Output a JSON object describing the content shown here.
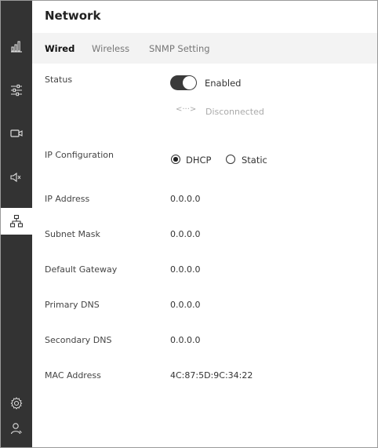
{
  "page": {
    "title": "Network"
  },
  "tabs": [
    {
      "label": "Wired"
    },
    {
      "label": "Wireless"
    },
    {
      "label": "SNMP Setting"
    }
  ],
  "status": {
    "label": "Status",
    "toggle_label": "Enabled",
    "link_text": "Disconnected"
  },
  "ip_config": {
    "label": "IP Configuration",
    "option_dhcp": "DHCP",
    "option_static": "Static",
    "selected": "DHCP"
  },
  "fields": [
    {
      "label": "IP Address",
      "value": "0.0.0.0"
    },
    {
      "label": "Subnet Mask",
      "value": "0.0.0.0"
    },
    {
      "label": "Default Gateway",
      "value": "0.0.0.0"
    },
    {
      "label": "Primary DNS",
      "value": "0.0.0.0"
    },
    {
      "label": "Secondary DNS",
      "value": "0.0.0.0"
    },
    {
      "label": "MAC Address",
      "value": "4C:87:5D:9C:34:22"
    }
  ],
  "sidebar": {
    "icons": [
      "bar-chart-icon",
      "sliders-icon",
      "video-camera-icon",
      "speaker-icon",
      "network-icon",
      "gear-icon",
      "user-icon"
    ],
    "active": "network-icon"
  },
  "colors": {
    "sidebar_bg": "#333333",
    "tabbar_bg": "#f3f3f3",
    "toggle_on": "#3a3a3a"
  }
}
